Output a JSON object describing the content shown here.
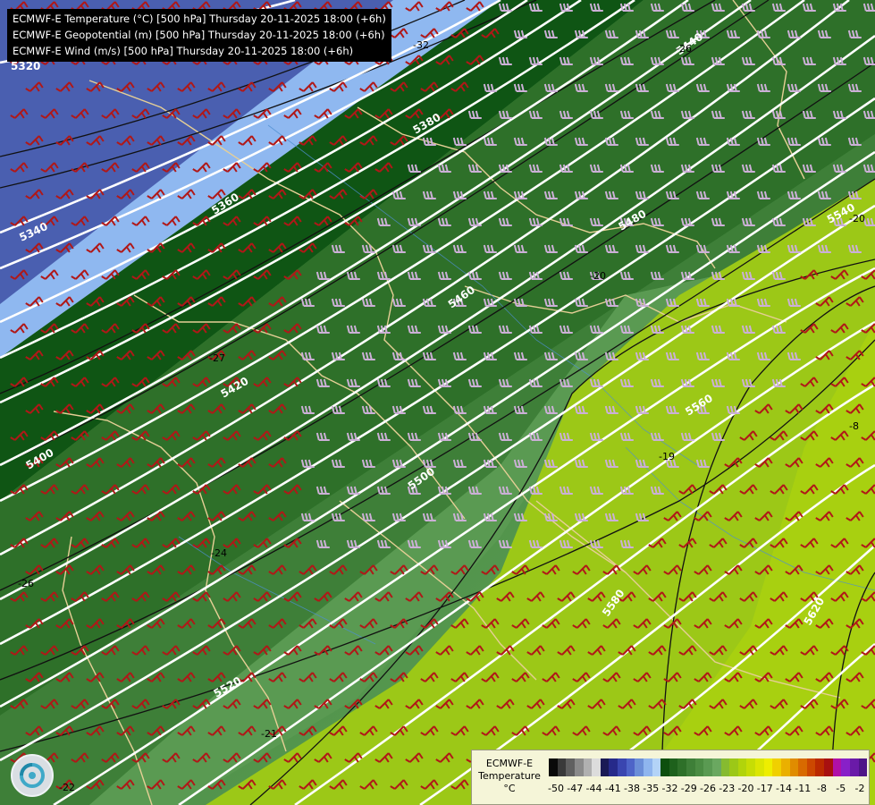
{
  "header": {
    "lines": [
      "ECMWF-E Temperature (°C) [500 hPa] Thursday 20-11-2025 18:00 (+6h)",
      "ECMWF-E Geopotential (m) [500 hPa] Thursday 20-11-2025 18:00 (+6h)",
      "ECMWF-E Wind (m/s) [500 hPa] Thursday 20-11-2025 18:00 (+6h)"
    ]
  },
  "geopotential_labels": [
    "5320",
    "5340",
    "5360",
    "5380",
    "5400",
    "5420",
    "5440",
    "5460",
    "5480",
    "5500",
    "5520",
    "5540",
    "5560",
    "5580",
    "5620"
  ],
  "temperature_labels": [
    "-32",
    "-26",
    "-27",
    "-26",
    "-24",
    "-21",
    "-22",
    "-19",
    "-20",
    "-20",
    "-8"
  ],
  "legend": {
    "title_line1": "ECMWF-E",
    "title_line2": "Temperature",
    "title_line3": "°C",
    "ticks": [
      "-50",
      "-47",
      "-44",
      "-41",
      "-38",
      "-35",
      "-32",
      "-29",
      "-26",
      "-23",
      "-20",
      "-17",
      "-14",
      "-11",
      "-8",
      "-5",
      "-2"
    ],
    "colors": [
      "#0a0a0a",
      "#3a3a3a",
      "#606060",
      "#8a8a8a",
      "#b0b0b0",
      "#dcdcdc",
      "#1a1a55",
      "#262a8a",
      "#3a46b0",
      "#4e64c8",
      "#6b8ed8",
      "#8fb5ee",
      "#b3d3f7",
      "#0d4f0d",
      "#1e611c",
      "#2e7029",
      "#3e7f38",
      "#4b8c43",
      "#5a9a52",
      "#6aa860",
      "#86bb30",
      "#9cc817",
      "#b1d40b",
      "#c6dd05",
      "#dbe602",
      "#eeee00",
      "#f0d000",
      "#eab000",
      "#e08c00",
      "#d86a00",
      "#cc4800",
      "#bb2a00",
      "#a81010",
      "#b010a8",
      "#8820c8",
      "#6a1aa8",
      "#4e1488"
    ]
  },
  "logo": {
    "icon": "meteo-logo-icon"
  },
  "map": {
    "colors": {
      "deep_blue": "#4a5fb0",
      "light_blue": "#8fb8f0",
      "dark_green": "#0f5514",
      "mid_green": "#3e7f38",
      "light_green": "#62a55a",
      "lime": "#9cc817",
      "wind_red": "#b01818",
      "wind_lilac": "#c8a8d0",
      "border_tan": "#e6cf96"
    }
  }
}
